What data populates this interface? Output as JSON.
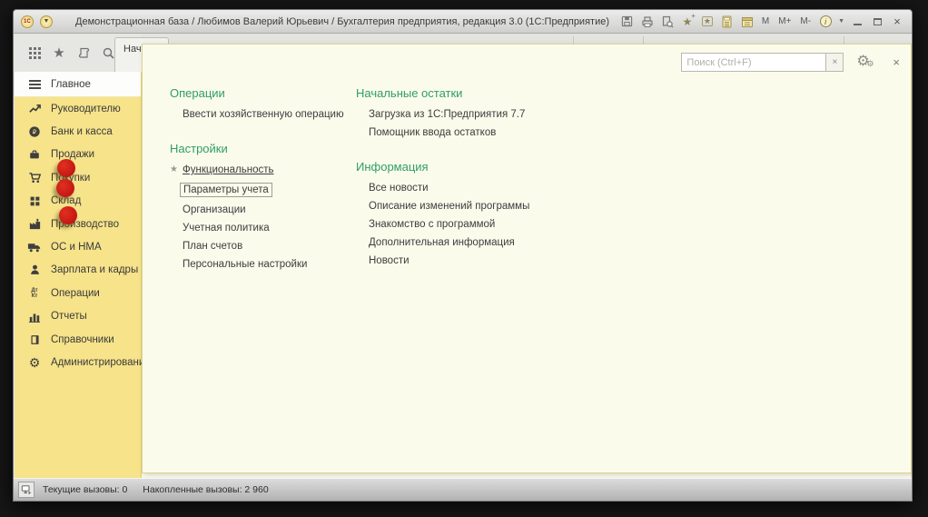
{
  "window": {
    "title": "Демонстрационная база / Любимов Валерий Юрьевич / Бухгалтерия предприятия, редакция 3.0  (1С:Предприятие)",
    "app_button_glyph": "1С",
    "dropdown_glyph": "▼",
    "memory_buttons": [
      "M",
      "M+",
      "M-"
    ],
    "info_glyph": "i",
    "close_glyph": "×",
    "star_glyph": "★",
    "star_plus_glyph": "+"
  },
  "toolbar": {
    "tab_label": "Нач"
  },
  "sidebar": {
    "selected": {
      "label": "Главное"
    },
    "items": [
      {
        "label": "Руководителю",
        "icon": "trend-up-icon"
      },
      {
        "label": "Банк и касса",
        "icon": "bank-icon"
      },
      {
        "label": "Продажи",
        "icon": "briefcase-icon"
      },
      {
        "label": "Покупки",
        "icon": "cart-icon"
      },
      {
        "label": "Склад",
        "icon": "pallet-icon"
      },
      {
        "label": "Производство",
        "icon": "factory-icon"
      },
      {
        "label": "ОС и НМА",
        "icon": "truck-icon"
      },
      {
        "label": "Зарплата и кадры",
        "icon": "person-icon"
      },
      {
        "label": "Операции",
        "icon": "debit-credit-icon",
        "icon_lines": [
          "Дт",
          "Кт"
        ]
      },
      {
        "label": "Отчеты",
        "icon": "bar-chart-icon"
      },
      {
        "label": "Справочники",
        "icon": "book-icon"
      },
      {
        "label": "Администрирование",
        "icon": "gear-icon",
        "gear_glyph": "⚙"
      }
    ]
  },
  "menu": {
    "sections": [
      {
        "title": "Операции",
        "links": [
          "Ввести хозяйственную операцию"
        ]
      },
      {
        "title": "Настройки",
        "links": [
          "Функциональность",
          "Параметры учета",
          "Организации",
          "Учетная политика",
          "План счетов",
          "Персональные настройки"
        ]
      },
      {
        "title": "Начальные остатки",
        "links": [
          "Загрузка из 1С:Предприятия 7.7",
          "Помощник ввода остатков"
        ]
      },
      {
        "title": "Информация",
        "links": [
          "Все новости",
          "Описание изменений программы",
          "Знакомство с программой",
          "Дополнительная информация",
          "Новости"
        ]
      }
    ],
    "favorite_star_glyph": "★",
    "gear_glyph": "⚙"
  },
  "search": {
    "placeholder": "Поиск (Ctrl+F)",
    "clear_glyph": "×"
  },
  "statusbar": {
    "current_calls": "Текущие вызовы: 0",
    "accumulated_calls": "Накопленные вызовы: 2 960"
  },
  "colors": {
    "heading_green": "#2f9e63",
    "sidebar_yellow": "#f6e38a",
    "panel_cream": "#fbfbec",
    "dot_red": "#b80d0d"
  }
}
